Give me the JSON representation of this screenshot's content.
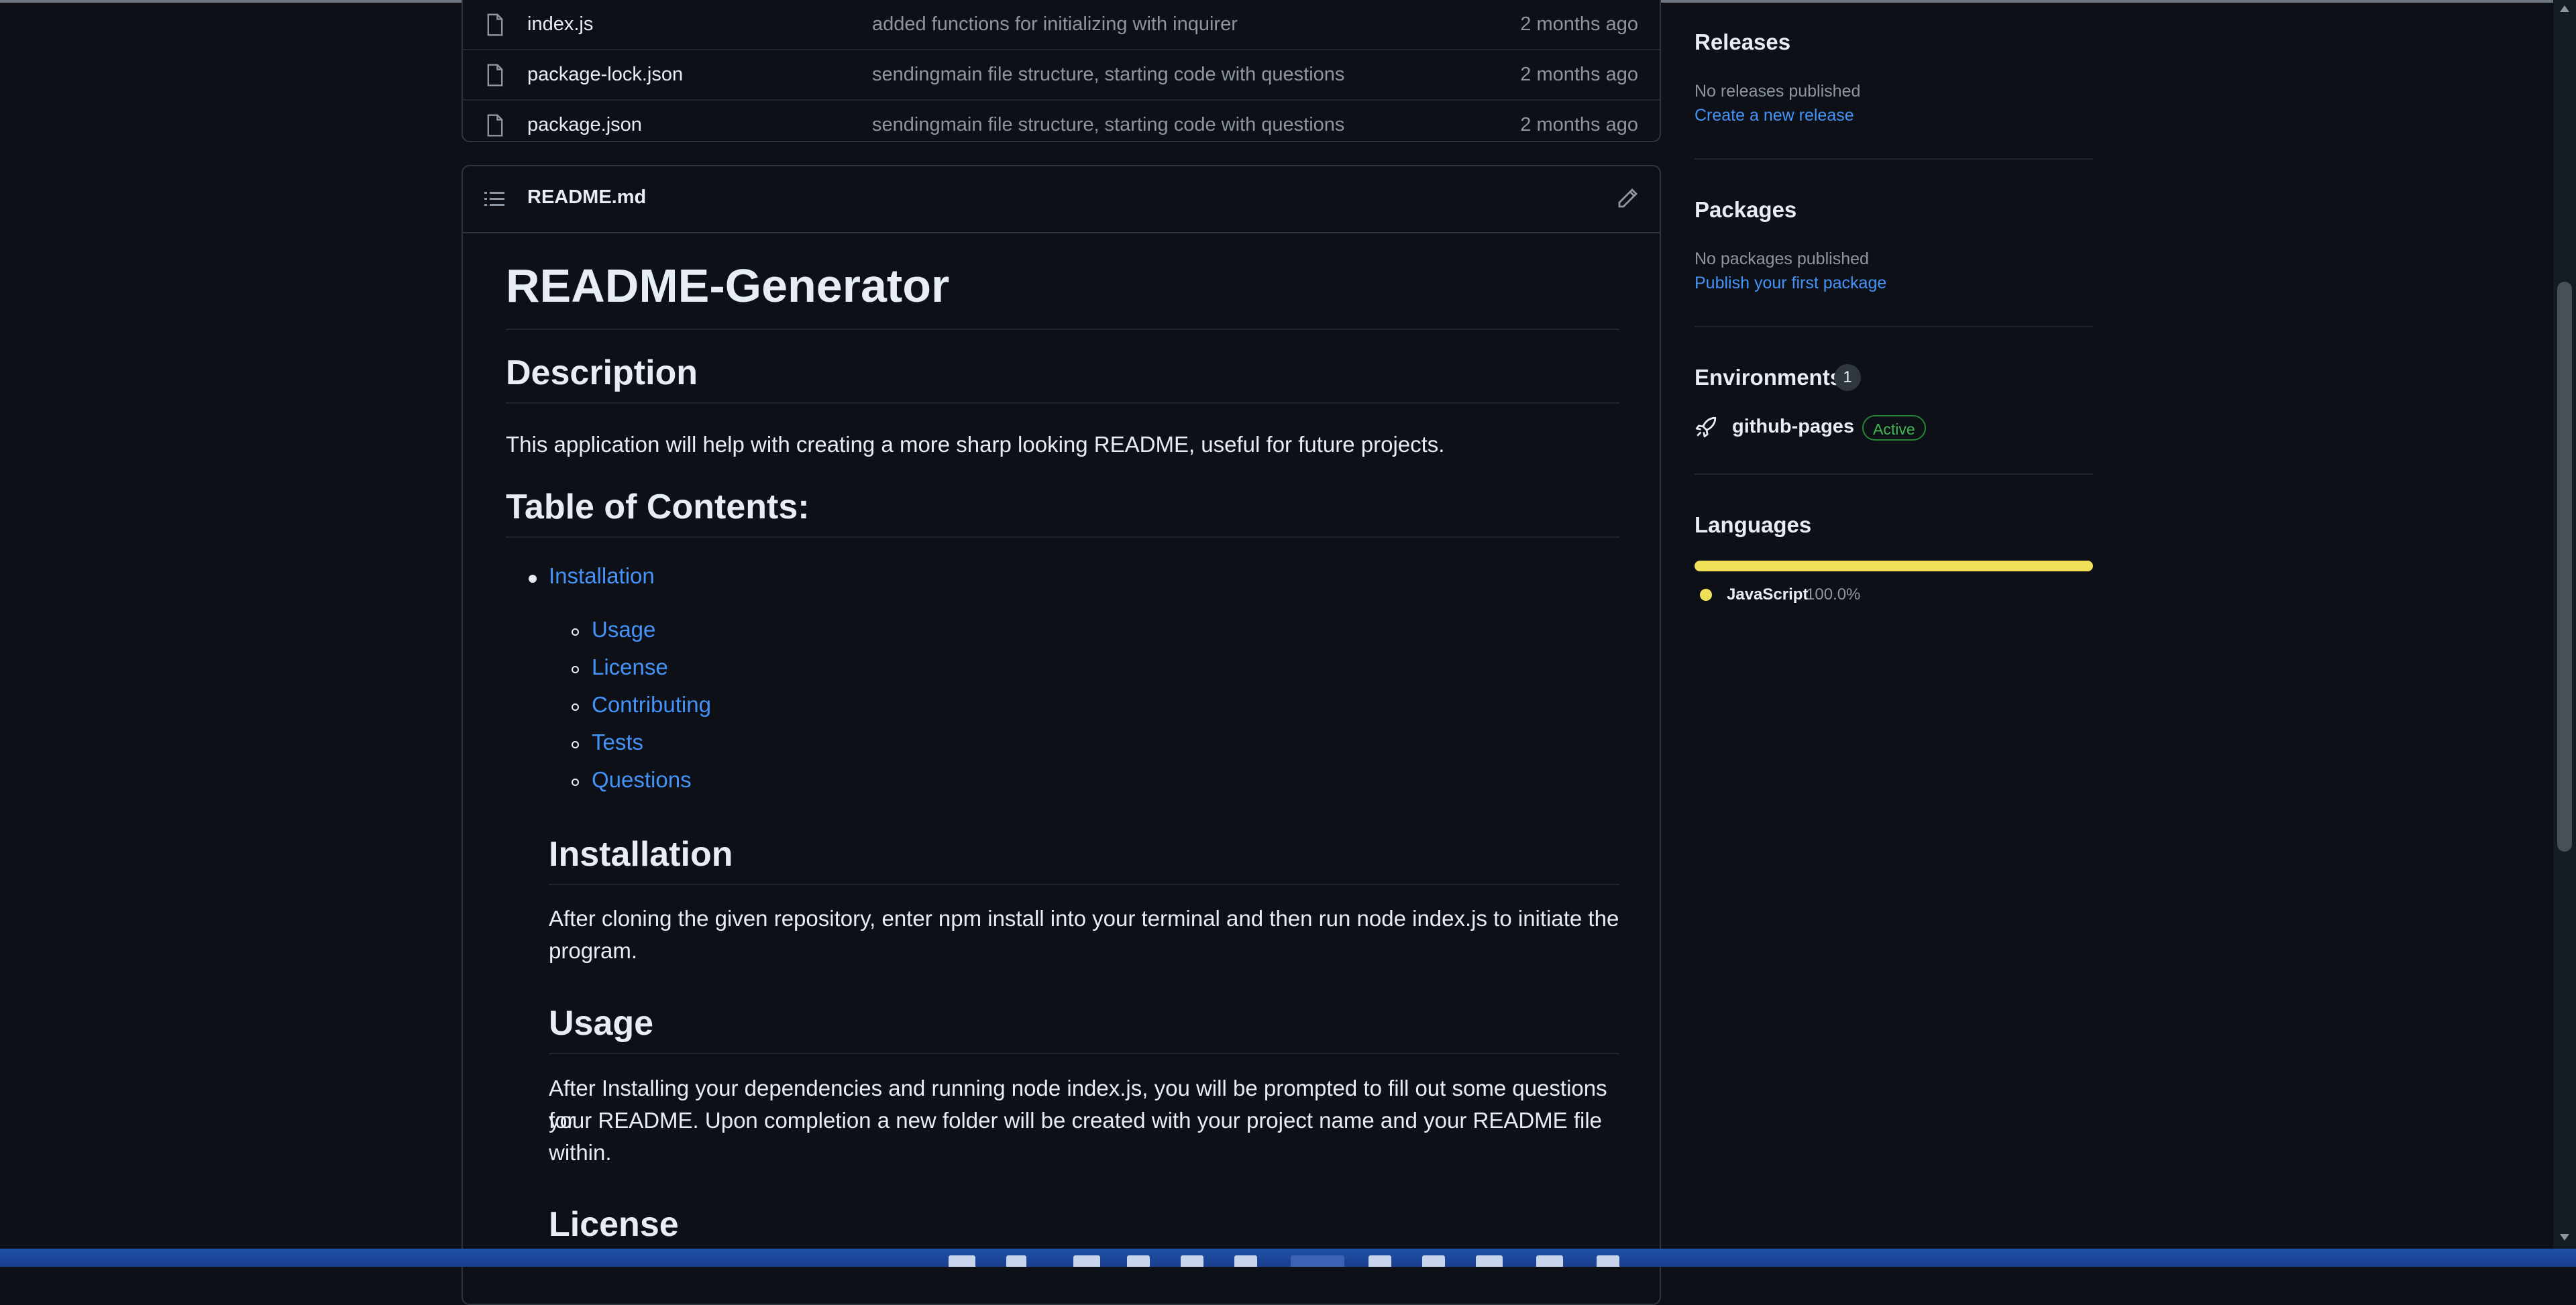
{
  "files": [
    {
      "name": "index.js",
      "message": "added functions for initializing with inquirer",
      "time": "2 months ago"
    },
    {
      "name": "package-lock.json",
      "message": "sendingmain file structure, starting code with questions",
      "time": "2 months ago"
    },
    {
      "name": "package.json",
      "message": "sendingmain file structure, starting code with questions",
      "time": "2 months ago"
    }
  ],
  "readme": {
    "filename": "README.md",
    "title": "README-Generator",
    "description_heading": "Description",
    "description_text": "This application will help with creating a more sharp looking README, useful for future projects.",
    "toc_heading": "Table of Contents:",
    "toc_top": "Installation",
    "toc_sub": [
      "Usage",
      "License",
      "Contributing",
      "Tests",
      "Questions"
    ],
    "installation_heading": "Installation",
    "installation_text_1": "After cloning the given repository, enter npm install into your terminal and then run node index.js to initiate the",
    "installation_text_2": "program.",
    "usage_heading": "Usage",
    "usage_text_1": "After Installing your dependencies and running node index.js, you will be prompted to fill out some questions for",
    "usage_text_2": "your README. Upon completion a new folder will be created with your project name and your README file",
    "usage_text_3": "within.",
    "license_heading": "License"
  },
  "sidebar": {
    "releases_title": "Releases",
    "releases_none": "No releases published",
    "releases_link": "Create a new release",
    "packages_title": "Packages",
    "packages_none": "No packages published",
    "packages_link": "Publish your first package",
    "environments_title": "Environments",
    "environments_count": "1",
    "environment_name": "github-pages",
    "environment_status": "Active",
    "languages_title": "Languages",
    "language_name": "JavaScript",
    "language_percent": "100.0%"
  },
  "colors": {
    "background": "#0d1117",
    "link": "#4493f8",
    "javascript": "#f1e05a",
    "active": "#3fb950"
  }
}
